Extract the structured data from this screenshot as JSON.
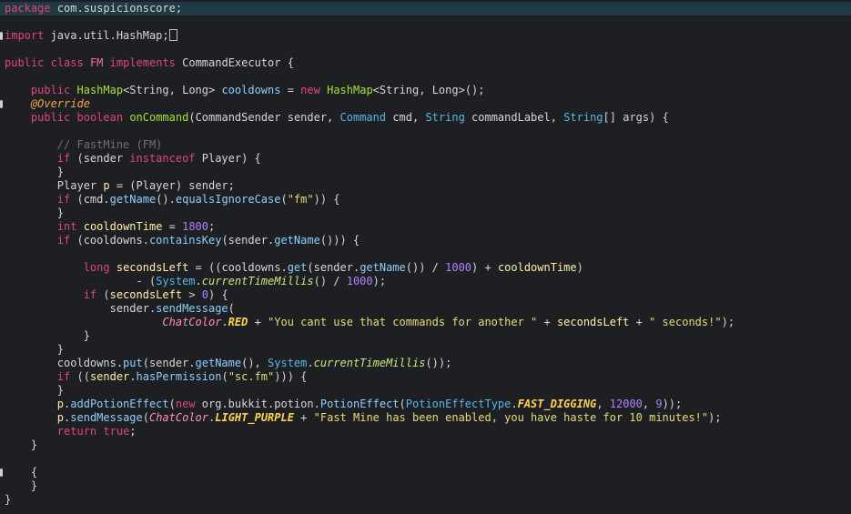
{
  "lines": [
    {
      "indent": 0,
      "tokens": [
        {
          "t": "package",
          "c": "kw"
        },
        {
          "t": " com.suspicionscore;"
        }
      ]
    },
    {
      "indent": 0,
      "tokens": []
    },
    {
      "indent": 0,
      "tokens": [
        {
          "t": "import",
          "c": "kw"
        },
        {
          "t": " java.util.HashMap;"
        }
      ]
    },
    {
      "indent": 0,
      "tokens": []
    },
    {
      "indent": 0,
      "tokens": [
        {
          "t": "public",
          "c": "kw"
        },
        {
          "t": " "
        },
        {
          "t": "class",
          "c": "kw"
        },
        {
          "t": " "
        },
        {
          "t": "FM",
          "c": "ty"
        },
        {
          "t": " "
        },
        {
          "t": "implements",
          "c": "kw"
        },
        {
          "t": " CommandExecutor {"
        }
      ]
    },
    {
      "indent": 0,
      "tokens": []
    },
    {
      "indent": 4,
      "tokens": [
        {
          "t": "public",
          "c": "kw"
        },
        {
          "t": " "
        },
        {
          "t": "HashMap",
          "c": "fn"
        },
        {
          "t": "<String, Long> "
        },
        {
          "t": "cooldowns",
          "c": "fld"
        },
        {
          "t": " = "
        },
        {
          "t": "new",
          "c": "kw"
        },
        {
          "t": " "
        },
        {
          "t": "HashMap",
          "c": "fn"
        },
        {
          "t": "<String, Long>();"
        }
      ]
    },
    {
      "indent": 4,
      "tokens": [
        {
          "t": "@Override",
          "c": "an"
        }
      ]
    },
    {
      "indent": 4,
      "tokens": [
        {
          "t": "public",
          "c": "kw"
        },
        {
          "t": " "
        },
        {
          "t": "boolean",
          "c": "kw"
        },
        {
          "t": " "
        },
        {
          "t": "onCommand",
          "c": "fn"
        },
        {
          "t": "(CommandSender sender, "
        },
        {
          "t": "Command",
          "c": "tyb"
        },
        {
          "t": " cmd, "
        },
        {
          "t": "String",
          "c": "tyb"
        },
        {
          "t": " commandLabel, "
        },
        {
          "t": "String",
          "c": "tyb"
        },
        {
          "t": "[] args) {"
        }
      ]
    },
    {
      "indent": 0,
      "tokens": []
    },
    {
      "indent": 8,
      "tokens": [
        {
          "t": "// FastMine (FM)",
          "c": "cm"
        }
      ]
    },
    {
      "indent": 8,
      "tokens": [
        {
          "t": "if",
          "c": "kw"
        },
        {
          "t": " (sender "
        },
        {
          "t": "instanceof",
          "c": "kw"
        },
        {
          "t": " Player) {"
        }
      ]
    },
    {
      "indent": 8,
      "tokens": [
        {
          "t": "}"
        }
      ]
    },
    {
      "indent": 8,
      "tokens": [
        {
          "t": "Player "
        },
        {
          "t": "p",
          "c": "var"
        },
        {
          "t": " = (Player) sender;"
        }
      ]
    },
    {
      "indent": 8,
      "tokens": [
        {
          "t": "if",
          "c": "kw"
        },
        {
          "t": " (cmd."
        },
        {
          "t": "getName",
          "c": "fld"
        },
        {
          "t": "()."
        },
        {
          "t": "equalsIgnoreCase",
          "c": "fld"
        },
        {
          "t": "("
        },
        {
          "t": "\"fm\"",
          "c": "st"
        },
        {
          "t": ")) {"
        }
      ]
    },
    {
      "indent": 8,
      "tokens": [
        {
          "t": "}"
        }
      ]
    },
    {
      "indent": 8,
      "tokens": [
        {
          "t": "int",
          "c": "kw"
        },
        {
          "t": " "
        },
        {
          "t": "cooldownTime",
          "c": "var"
        },
        {
          "t": " = "
        },
        {
          "t": "1800",
          "c": "num"
        },
        {
          "t": ";"
        }
      ]
    },
    {
      "indent": 8,
      "tokens": [
        {
          "t": "if",
          "c": "kw"
        },
        {
          "t": " (cooldowns."
        },
        {
          "t": "containsKey",
          "c": "fld"
        },
        {
          "t": "(sender."
        },
        {
          "t": "getName",
          "c": "fld"
        },
        {
          "t": "())) {"
        }
      ]
    },
    {
      "indent": 0,
      "tokens": []
    },
    {
      "indent": 12,
      "tokens": [
        {
          "t": "long",
          "c": "kw"
        },
        {
          "t": " "
        },
        {
          "t": "secondsLeft",
          "c": "var"
        },
        {
          "t": " = ((cooldowns."
        },
        {
          "t": "get",
          "c": "fld"
        },
        {
          "t": "(sender."
        },
        {
          "t": "getName",
          "c": "fld"
        },
        {
          "t": "()) / "
        },
        {
          "t": "1000",
          "c": "num"
        },
        {
          "t": ") + "
        },
        {
          "t": "cooldownTime",
          "c": "var"
        },
        {
          "t": ")"
        }
      ]
    },
    {
      "indent": 20,
      "tokens": [
        {
          "t": "- ("
        },
        {
          "t": "System",
          "c": "tyb"
        },
        {
          "t": "."
        },
        {
          "t": "currentTimeMillis",
          "c": "stt"
        },
        {
          "t": "() / "
        },
        {
          "t": "1000",
          "c": "num"
        },
        {
          "t": ");"
        }
      ]
    },
    {
      "indent": 12,
      "tokens": [
        {
          "t": "if",
          "c": "kw"
        },
        {
          "t": " ("
        },
        {
          "t": "secondsLeft",
          "c": "var"
        },
        {
          "t": " > "
        },
        {
          "t": "0",
          "c": "num"
        },
        {
          "t": ") {"
        }
      ]
    },
    {
      "indent": 16,
      "tokens": [
        {
          "t": "sender."
        },
        {
          "t": "sendMessage",
          "c": "fld"
        },
        {
          "t": "("
        }
      ]
    },
    {
      "indent": 24,
      "tokens": [
        {
          "t": "ChatColor",
          "c": "itc"
        },
        {
          "t": "."
        },
        {
          "t": "RED",
          "c": "itf"
        },
        {
          "t": " + "
        },
        {
          "t": "\"You cant use that commands for another \"",
          "c": "st"
        },
        {
          "t": " + "
        },
        {
          "t": "secondsLeft",
          "c": "var"
        },
        {
          "t": " + "
        },
        {
          "t": "\" seconds!\"",
          "c": "st"
        },
        {
          "t": ");"
        }
      ]
    },
    {
      "indent": 12,
      "tokens": [
        {
          "t": "}"
        }
      ]
    },
    {
      "indent": 8,
      "tokens": [
        {
          "t": "}"
        }
      ]
    },
    {
      "indent": 8,
      "tokens": [
        {
          "t": "cooldowns."
        },
        {
          "t": "put",
          "c": "fld"
        },
        {
          "t": "(sender."
        },
        {
          "t": "getName",
          "c": "fld"
        },
        {
          "t": "(), "
        },
        {
          "t": "System",
          "c": "tyb"
        },
        {
          "t": "."
        },
        {
          "t": "currentTimeMillis",
          "c": "stt"
        },
        {
          "t": "());"
        }
      ]
    },
    {
      "indent": 8,
      "tokens": [
        {
          "t": "if",
          "c": "kw"
        },
        {
          "t": " (("
        },
        {
          "t": "sender",
          "c": "var"
        },
        {
          "t": "."
        },
        {
          "t": "hasPermission",
          "c": "fld"
        },
        {
          "t": "("
        },
        {
          "t": "\"sc.fm\"",
          "c": "st"
        },
        {
          "t": "))) {"
        }
      ]
    },
    {
      "indent": 8,
      "tokens": [
        {
          "t": "}"
        }
      ]
    },
    {
      "indent": 8,
      "tokens": [
        {
          "t": "p",
          "c": "var"
        },
        {
          "t": "."
        },
        {
          "t": "addPotionEffect",
          "c": "fld"
        },
        {
          "t": "("
        },
        {
          "t": "new",
          "c": "kw"
        },
        {
          "t": " org.bukkit.potion."
        },
        {
          "t": "PotionEffect",
          "c": "fld"
        },
        {
          "t": "("
        },
        {
          "t": "PotionEffectType",
          "c": "tyb"
        },
        {
          "t": "."
        },
        {
          "t": "FAST_DIGGING",
          "c": "itf"
        },
        {
          "t": ", "
        },
        {
          "t": "12000",
          "c": "num"
        },
        {
          "t": ", "
        },
        {
          "t": "9",
          "c": "num"
        },
        {
          "t": "));"
        }
      ]
    },
    {
      "indent": 8,
      "tokens": [
        {
          "t": "p",
          "c": "var"
        },
        {
          "t": "."
        },
        {
          "t": "sendMessage",
          "c": "fld"
        },
        {
          "t": "("
        },
        {
          "t": "ChatColor",
          "c": "itc"
        },
        {
          "t": "."
        },
        {
          "t": "LIGHT_PURPLE",
          "c": "itf"
        },
        {
          "t": " + "
        },
        {
          "t": "\"Fast Mine has been enabled, you have haste for 10 minutes!\"",
          "c": "st"
        },
        {
          "t": ");"
        }
      ]
    },
    {
      "indent": 8,
      "tokens": [
        {
          "t": "return",
          "c": "kw"
        },
        {
          "t": " "
        },
        {
          "t": "true",
          "c": "kw"
        },
        {
          "t": ";"
        }
      ]
    },
    {
      "indent": 4,
      "tokens": [
        {
          "t": "}"
        }
      ]
    },
    {
      "indent": 0,
      "tokens": []
    },
    {
      "indent": 4,
      "tokens": [
        {
          "t": "{"
        }
      ]
    },
    {
      "indent": 4,
      "tokens": [
        {
          "t": "}"
        }
      ]
    },
    {
      "indent": 0,
      "tokens": [
        {
          "t": "}"
        }
      ]
    }
  ],
  "markers": [
    2,
    7,
    34
  ],
  "cursor_line": 2
}
